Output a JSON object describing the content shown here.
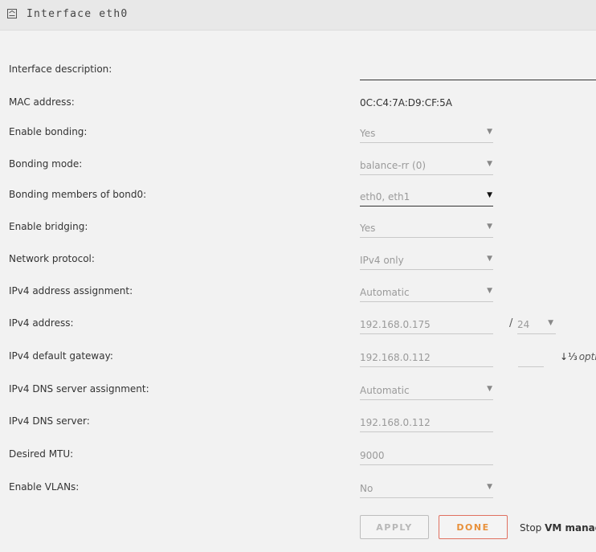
{
  "window": {
    "title": "Interface eth0",
    "icon": "network-interface-icon"
  },
  "form": {
    "description": {
      "label": "Interface description:",
      "value": ""
    },
    "mac": {
      "label": "MAC address:",
      "value": "0C:C4:7A:D9:CF:5A"
    },
    "bonding": {
      "label": "Enable bonding:",
      "value": "Yes"
    },
    "bonding_mode": {
      "label": "Bonding mode:",
      "value": "balance-rr (0)"
    },
    "bonding_members": {
      "label": "Bonding members of bond0:",
      "value": "eth0, eth1"
    },
    "bridging": {
      "label": "Enable bridging:",
      "value": "Yes"
    },
    "protocol": {
      "label": "Network protocol:",
      "value": "IPv4 only"
    },
    "ipv4_assign": {
      "label": "IPv4 address assignment:",
      "value": "Automatic"
    },
    "ipv4_address": {
      "label": "IPv4 address:",
      "value": "192.168.0.175",
      "prefix": "24",
      "slash": "/"
    },
    "ipv4_gateway": {
      "label": "IPv4 default gateway:",
      "value": "192.168.0.112",
      "metric_value": "",
      "optional_label": "optio",
      "sort_glyph": "↓⅓"
    },
    "dns_assign": {
      "label": "IPv4 DNS server assignment:",
      "value": "Automatic"
    },
    "dns_server": {
      "label": "IPv4 DNS server:",
      "value": "192.168.0.112"
    },
    "mtu": {
      "label": "Desired MTU:",
      "value": "9000"
    },
    "vlans": {
      "label": "Enable VLANs:",
      "value": "No"
    }
  },
  "actions": {
    "apply_label": "APPLY",
    "done_label": "DONE",
    "stop_prefix": "Stop ",
    "stop_bold": "VM manage"
  },
  "colors": {
    "done_border": "#e07060",
    "done_text": "#e8903a",
    "apply_text": "#b8b8b8"
  }
}
